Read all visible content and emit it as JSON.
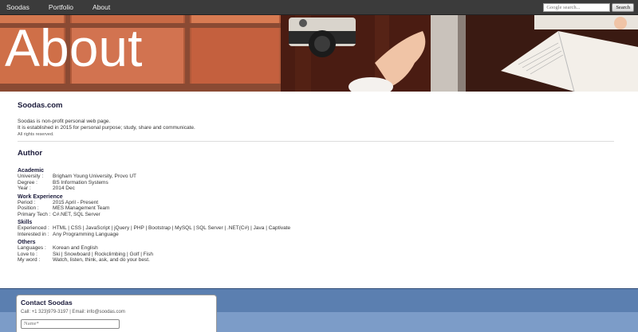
{
  "nav": {
    "brand": "Soodas",
    "items": [
      "Portfolio",
      "About"
    ],
    "search_placeholder": "Google search...",
    "search_button": "Search"
  },
  "hero": {
    "title": "About"
  },
  "site": {
    "heading": "Soodas.com",
    "intro1": "Soodas is non-profit personal web page.",
    "intro2": "It is established in 2015 for personal purpose; study, share and communicate.",
    "rights": "All rights reserved."
  },
  "author": {
    "heading": "Author",
    "sections": [
      {
        "title": "Academic",
        "rows": [
          {
            "k": "University :",
            "v": "Brigham Young University, Provo UT"
          },
          {
            "k": "Degree :",
            "v": "BS Information Systems"
          },
          {
            "k": "Year :",
            "v": "2014 Dec"
          }
        ]
      },
      {
        "title": "Work Experience",
        "rows": [
          {
            "k": "Period :",
            "v": "2015 April - Present"
          },
          {
            "k": "Position :",
            "v": "MES Management Team"
          },
          {
            "k": "Primary Tech :",
            "v": "C#.NET, SQL Server"
          }
        ]
      },
      {
        "title": "Skills",
        "rows": [
          {
            "k": "Experienced :",
            "v": "HTML | CSS | JavaScript | jQuery | PHP | Bootstrap | MySQL | SQL Server | .NET(C#) | Java | Captivate"
          },
          {
            "k": "Interested in :",
            "v": "Any Programming Language"
          }
        ]
      },
      {
        "title": "Others",
        "rows": [
          {
            "k": "Languages :",
            "v": "Korean and English"
          },
          {
            "k": "Love to :",
            "v": "Ski | Snowboard | Rockclimbing | Golf | Fish"
          },
          {
            "k": "My word :",
            "v": "Watch, listen, think, ask, and do your best."
          }
        ]
      }
    ]
  },
  "contact": {
    "title": "Contact Soodas",
    "line": "Call: +1 323)979-3197 | Email: info@soodas.com",
    "name_placeholder": "Name*"
  }
}
